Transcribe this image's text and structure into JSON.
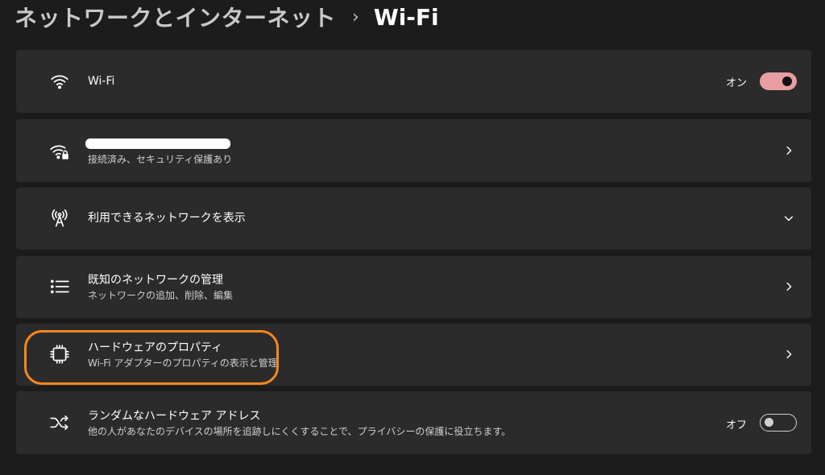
{
  "breadcrumb": {
    "parent": "ネットワークとインターネット",
    "separator": "›",
    "current": "Wi-Fi"
  },
  "wifi": {
    "title": "Wi-Fi",
    "toggle_label": "オン",
    "toggle_state": "on"
  },
  "connected": {
    "network_name": "",
    "subtitle": "接続済み、セキュリティ保護あり"
  },
  "available": {
    "title": "利用できるネットワークを表示"
  },
  "known": {
    "title": "既知のネットワークの管理",
    "subtitle": "ネットワークの追加、削除、編集"
  },
  "hardware": {
    "title": "ハードウェアのプロパティ",
    "subtitle": "Wi-Fi アダプターのプロパティの表示と管理"
  },
  "random": {
    "title": "ランダムなハードウェア アドレス",
    "subtitle": "他の人があなたのデバイスの場所を追跡しにくくすることで、プライバシーの保護に役立ちます。",
    "toggle_label": "オフ",
    "toggle_state": "off"
  },
  "colors": {
    "background": "#1c1c1c",
    "card": "#2b2b2b",
    "accent_toggle": "#e89da0",
    "highlight": "#f5871f"
  },
  "icons": [
    "wifi-icon",
    "wifi-lock-icon",
    "antenna-icon",
    "list-icon",
    "chip-icon",
    "shuffle-icon",
    "chevron-right-icon",
    "chevron-down-icon"
  ]
}
